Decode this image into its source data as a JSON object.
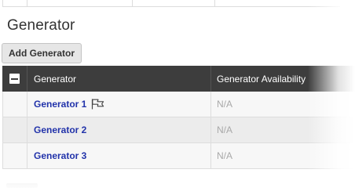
{
  "section": {
    "title": "Generator"
  },
  "toolbar": {
    "add_label": "Add Generator"
  },
  "table": {
    "columns": [
      "Generator",
      "Generator Availability"
    ],
    "rows": [
      {
        "name": "Generator 1",
        "availability": "N/A",
        "flag_icon": "flag-outline-icon"
      },
      {
        "name": "Generator 2",
        "availability": "N/A"
      },
      {
        "name": "Generator 3",
        "availability": "N/A"
      }
    ]
  },
  "colors": {
    "header_bg": "#3d3d3d",
    "link": "#2233aa",
    "na_text": "#a9a9a9",
    "alt_row": "#ececec"
  }
}
